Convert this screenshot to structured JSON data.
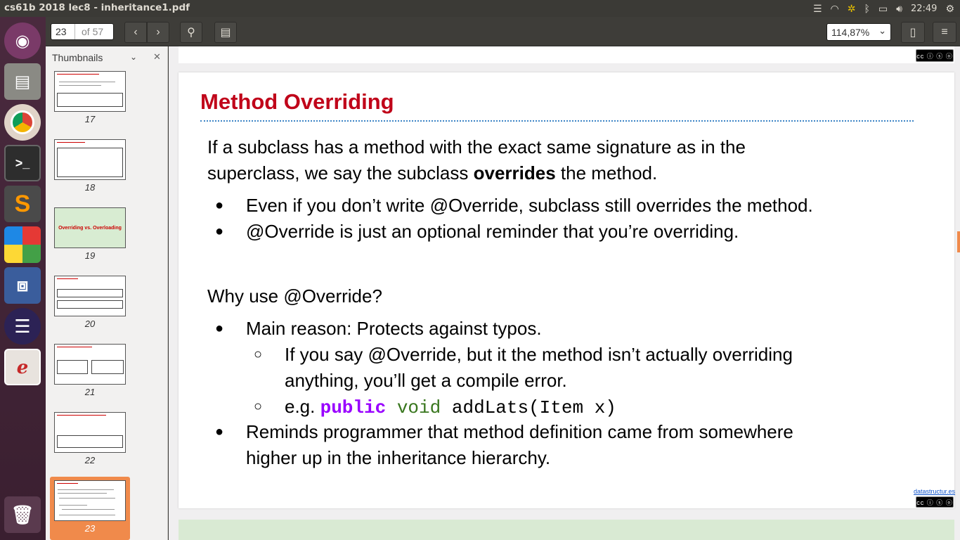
{
  "window": {
    "title": "cs61b 2018 lec8 - inheritance1.pdf"
  },
  "tray": {
    "clock": "22:49"
  },
  "toolbar": {
    "page_current": "23",
    "page_total": "of 57",
    "zoom": "114,87%"
  },
  "sidebar": {
    "header": "Thumbnails",
    "thumbs": [
      {
        "num": "17"
      },
      {
        "num": "18"
      },
      {
        "num": "19",
        "label": "Overriding vs. Overloading"
      },
      {
        "num": "20"
      },
      {
        "num": "21"
      },
      {
        "num": "22"
      },
      {
        "num": "23"
      }
    ]
  },
  "slide": {
    "title": "Method Overriding",
    "intro_line1": "If a subclass has a method with the exact same signature as in the",
    "intro_line2a": "superclass, we say the subclass ",
    "intro_bold": "overrides",
    "intro_line2b": " the method.",
    "bullet1": "Even if you don’t write @Override, subclass still overrides the method.",
    "bullet2": "@Override is just an optional reminder that you’re overriding.",
    "why": "Why use @Override?",
    "bullet3": "Main reason: Protects against typos.",
    "sub1_line1": "If you say @Override, but it the method isn’t actually overriding",
    "sub1_line2": "anything, you’ll get a compile error.",
    "sub2_prefix": "e.g. ",
    "sub2_kw1": "public",
    "sub2_kw2": "void",
    "sub2_code": "addLats(Item x)",
    "bullet4_line1": "Reminds programmer that method definition came from somewhere",
    "bullet4_line2": "higher up in the inheritance hierarchy.",
    "footer_link": "datastructur.es"
  }
}
